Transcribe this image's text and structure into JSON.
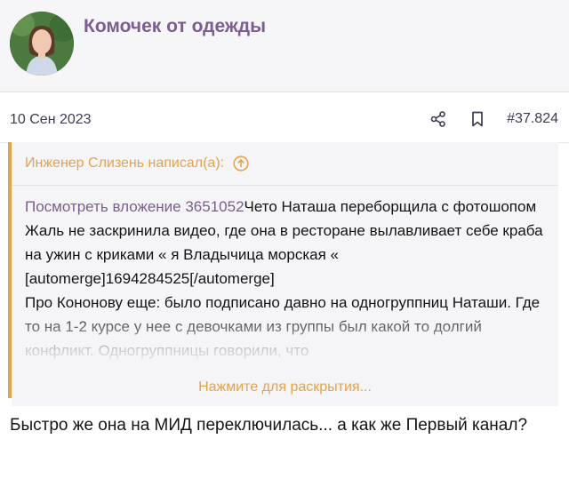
{
  "post": {
    "author": "Комочек от одежды",
    "date": "10 Сен 2023",
    "number": "#37.824",
    "icons": {
      "share": "share-icon",
      "bookmark": "bookmark-icon",
      "quote_arrow": "arrow-up-circle-icon"
    }
  },
  "quote": {
    "header": "Инженер Слизень написал(а):",
    "attachment_link": "Посмотреть вложение 3651052",
    "line1_tail": "Чето Наташа переборщила с фотошопом",
    "line2": "Жаль не заскринила видео, где она в ресторане вылавливает себе краба на ужин с криками « я Владычица морская «",
    "line3": "[automerge]1694284525[/automerge]",
    "line4": "Про Кононову еще: было подписано давно на одногруппниц Наташи. Где то на 1-2 курсе у нее с девочками из группы был какой то долгий конфликт. Одногруппницы говорили, что",
    "expand_label": "Нажмите для раскрытия..."
  },
  "reply": {
    "text": "Быстро же она на МИД переключилась... а как же Первый канал?"
  },
  "colors": {
    "author": "#7b5e8f",
    "quote_accent": "#e6a24a",
    "link": "#7b5e8f"
  }
}
